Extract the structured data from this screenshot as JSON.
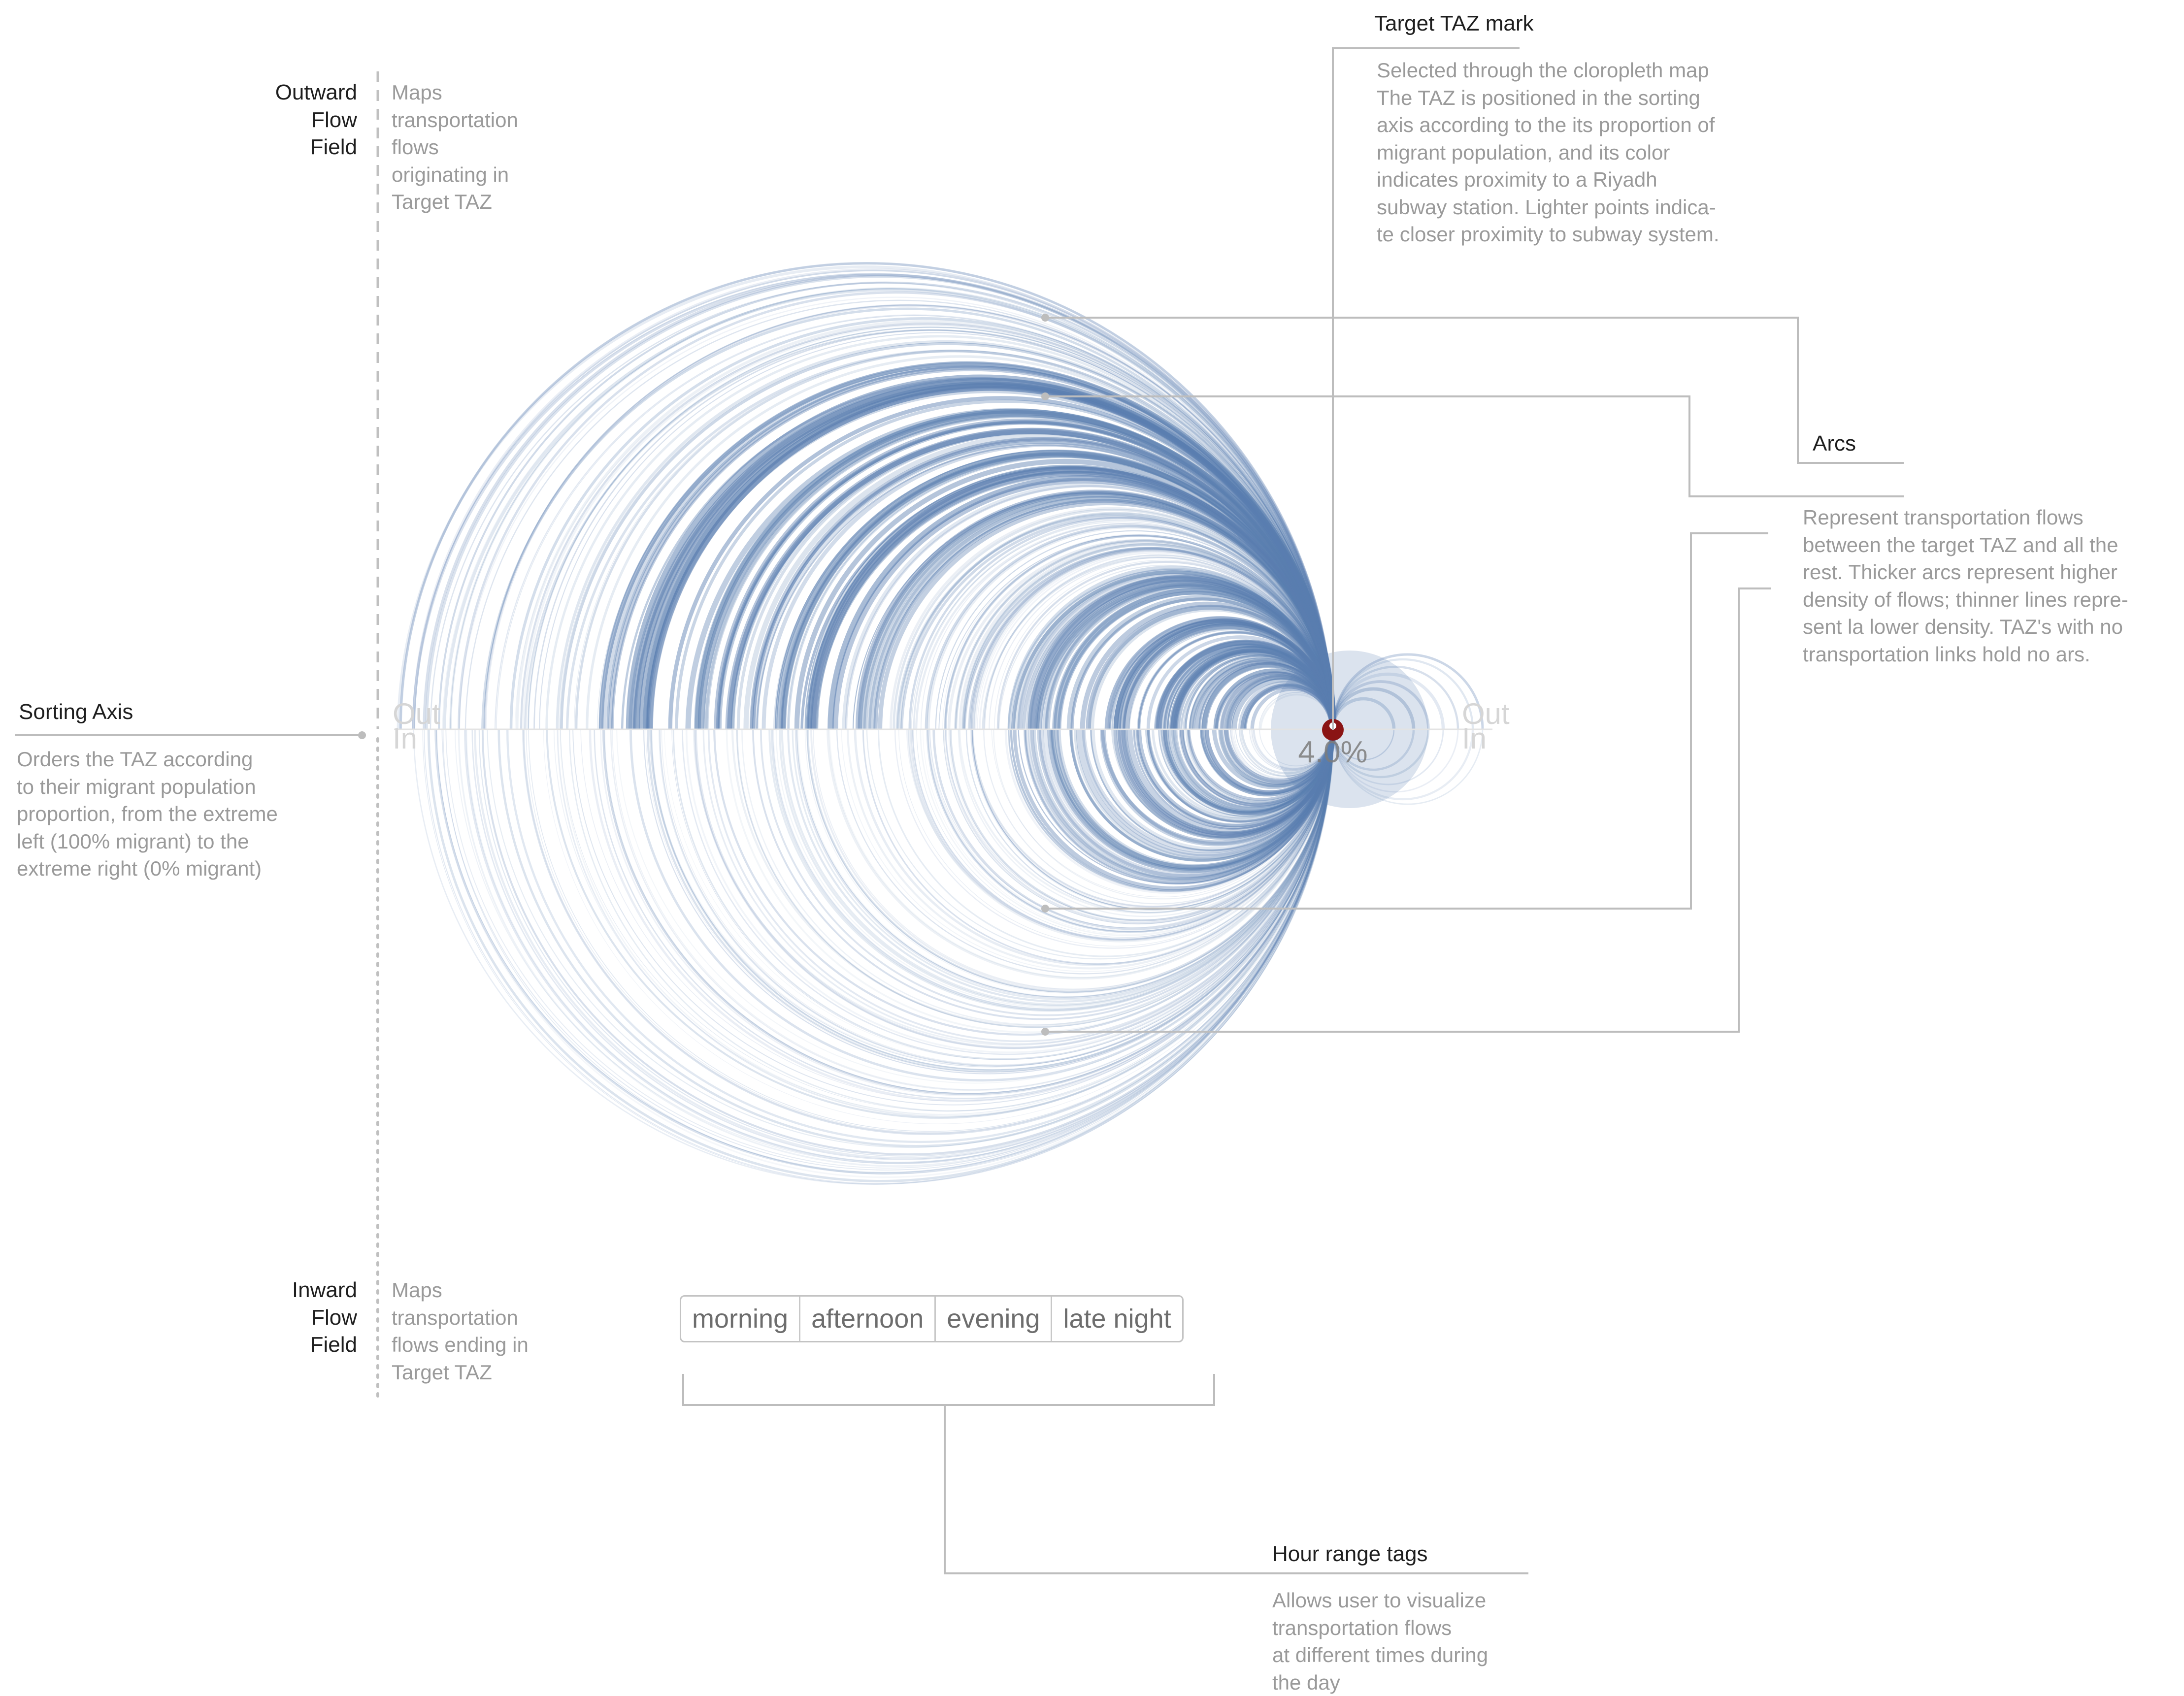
{
  "colors": {
    "arc": "#5a7eb0",
    "arc_light": "#b9c9de",
    "leader": "#bdbdbd",
    "axis_label": "#d6d6d6",
    "target_mark": "#8a1414",
    "title_text": "#1e1e1e",
    "body_text": "#9a9a9a"
  },
  "annotations": {
    "target_taz": {
      "title": "Target TAZ mark",
      "body": "Selected through the cloropleth map\nThe TAZ is positioned in the sorting\naxis according to the its proportion of\nmigrant population, and its color\nindicates proximity to a Riyadh\nsubway station. Lighter points indica-\nte closer proximity to subway system."
    },
    "arcs": {
      "title": "Arcs",
      "body": "Represent transportation flows\nbetween the target TAZ and all the\nrest. Thicker arcs represent higher\ndensity of flows; thinner lines repre-\nsent la lower density. TAZ's with no\ntransportation links hold no ars."
    },
    "sorting_axis": {
      "title": "Sorting Axis",
      "body": "Orders the TAZ according\nto their migrant population\nproportion, from the extreme\nleft (100% migrant) to the\nextreme right (0% migrant)"
    },
    "outward_field": {
      "title": "Outward\nFlow\nField",
      "body": "Maps\ntransportation\nflows\noriginating in\nTarget TAZ"
    },
    "inward_field": {
      "title": "Inward\nFlow\nField",
      "body": "Maps\ntransportation\nflows ending in\nTarget TAZ"
    },
    "hour_tags": {
      "title": "Hour range tags",
      "body": "Allows user to visualize\ntransportation flows\nat different times during\nthe day"
    }
  },
  "axis_labels": {
    "left_out": "Out",
    "left_in": "In",
    "right_out": "Out",
    "right_in": "In",
    "target_value": "4.0%"
  },
  "hour_tags": [
    "morning",
    "afternoon",
    "evening",
    "late night"
  ]
}
